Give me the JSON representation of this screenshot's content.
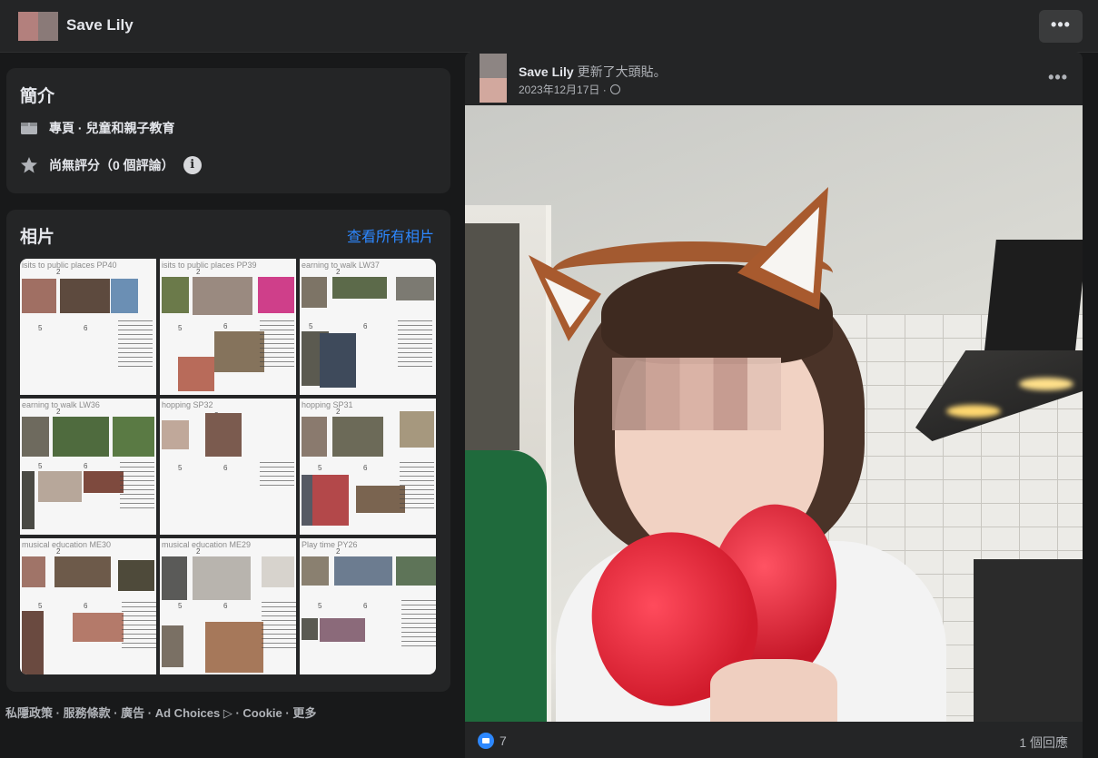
{
  "header": {
    "page_name": "Save Lily",
    "more_label": "•••"
  },
  "intro": {
    "title": "簡介",
    "category": "專頁 · 兒童和親子教育",
    "rating": "尚無評分（0 個評論）",
    "info_icon": "i"
  },
  "photos": {
    "title": "相片",
    "see_all": "查看所有相片",
    "items": [
      {
        "caption": "isits to public places PP40",
        "n1": "2",
        "n2": "5",
        "n3": "6"
      },
      {
        "caption": "isits to public places PP39",
        "n1": "2",
        "n2": "5",
        "n3": "6"
      },
      {
        "caption": "earning to walk LW37",
        "n1": "2",
        "n2": "5",
        "n3": "6"
      },
      {
        "caption": "earning to walk LW36",
        "n1": "2",
        "n2": "5",
        "n3": "6"
      },
      {
        "caption": "hopping SP32",
        "n1": "2",
        "n2": "5",
        "n3": "6"
      },
      {
        "caption": "hopping SP31",
        "n1": "2",
        "n2": "5",
        "n3": "6"
      },
      {
        "caption": "musical education ME30",
        "n1": "2",
        "n2": "5",
        "n3": "6"
      },
      {
        "caption": "musical education ME29",
        "n1": "2",
        "n2": "5",
        "n3": "6"
      },
      {
        "caption": "Play time PY26",
        "n1": "2",
        "n2": "5",
        "n3": "6"
      }
    ]
  },
  "footer": {
    "links": [
      "私隱政策",
      "服務條款",
      "廣告",
      "Ad Choices ▷",
      "Cookie",
      "更多"
    ],
    "separator": " · "
  },
  "post": {
    "author": "Save Lily",
    "action": "更新了大頭貼。",
    "date": "2023年12月17日 ·",
    "more_label": "•••",
    "like_count": "7",
    "comments": "1 個回應"
  }
}
